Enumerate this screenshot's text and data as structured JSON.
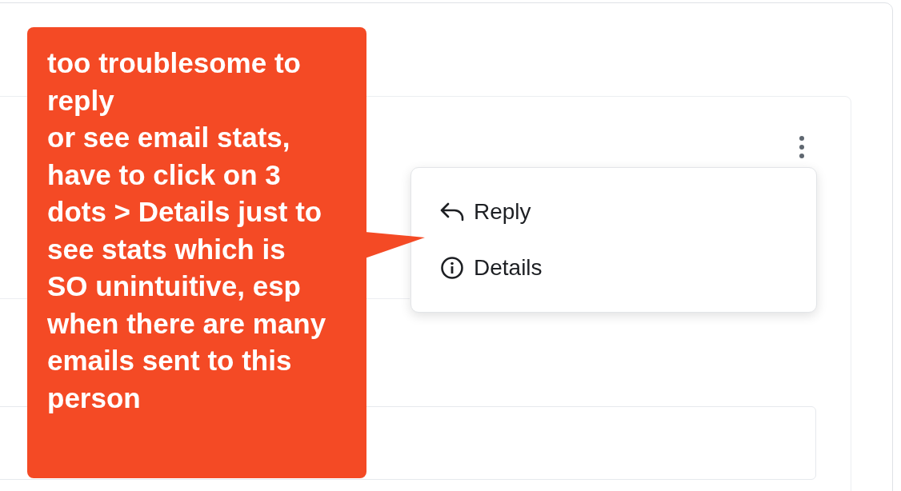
{
  "menu": {
    "items": [
      {
        "kind": "reply",
        "label": "Reply"
      },
      {
        "kind": "details",
        "label": "Details"
      }
    ]
  },
  "callout": {
    "paragraphs": [
      "too troublesome to reply",
      "or see email stats, have to click on 3 dots > Details just to see stats which is SO unintuitive, esp when there are many emails sent to this person"
    ]
  }
}
